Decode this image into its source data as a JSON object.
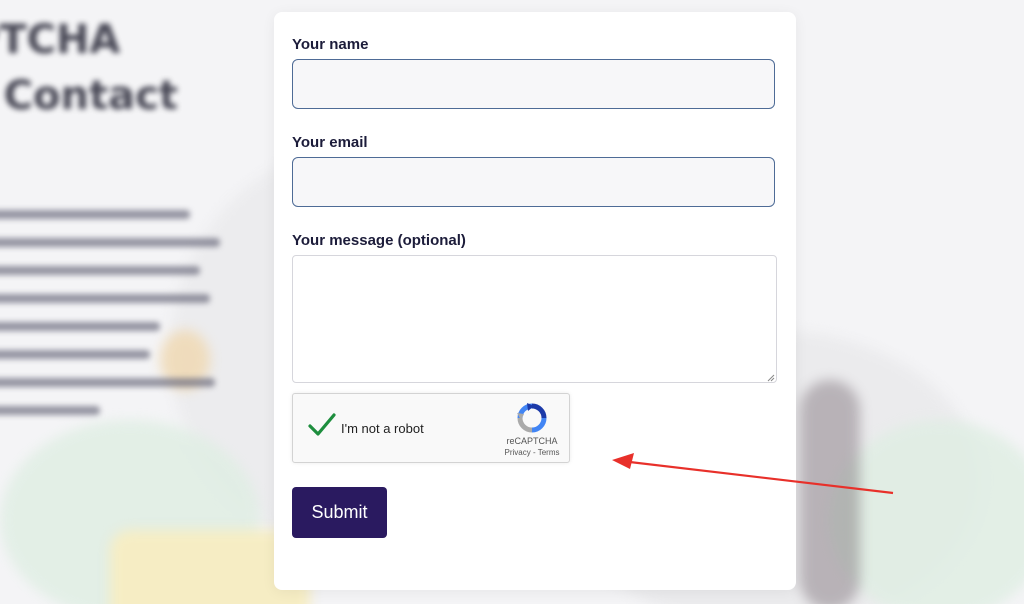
{
  "background": {
    "heading_line_1": "PTCHA",
    "heading_line_2": "r Contact"
  },
  "form": {
    "name_label": "Your name",
    "name_value": "",
    "email_label": "Your email",
    "email_value": "",
    "message_label": "Your message (optional)",
    "message_value": "",
    "submit_label": "Submit"
  },
  "recaptcha": {
    "checkbox_label": "I'm not a robot",
    "checked": true,
    "brand": "reCAPTCHA",
    "privacy_link": "Privacy",
    "separator": " - ",
    "terms_link": "Terms"
  },
  "annotation": {
    "arrow_color": "#e8302a",
    "points_to": "recaptcha-widget"
  },
  "colors": {
    "submit_bg": "#2a1a60",
    "field_border": "#4e6b96",
    "check_green": "#1e8e3e",
    "label_text": "#1c1c3a"
  },
  "icons": {
    "check": "check-icon",
    "recaptcha_logo": "recaptcha-logo-icon"
  }
}
